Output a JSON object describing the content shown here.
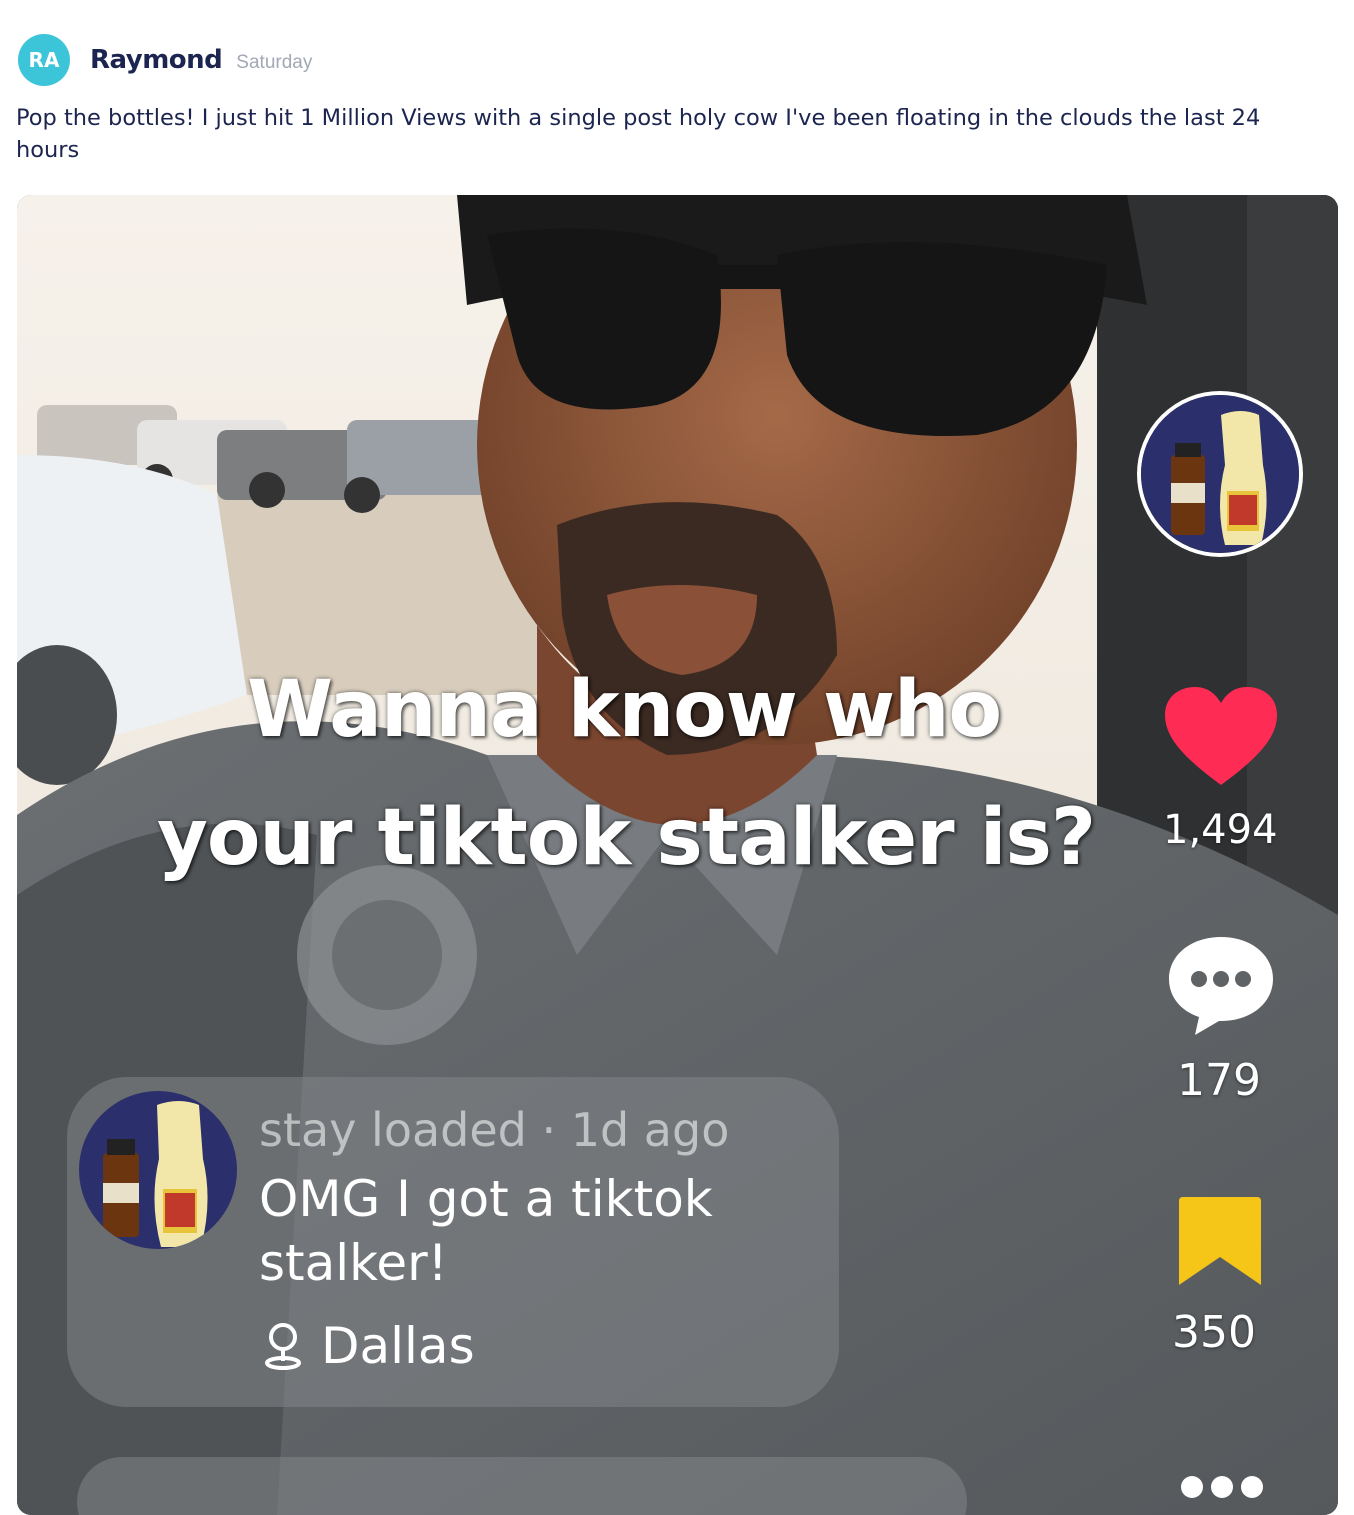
{
  "post": {
    "avatar_initials": "RA",
    "author": "Raymond",
    "time": "Saturday",
    "text": "Pop the bottles! I just hit 1 Million Views with a single post holy cow I've been floating in the clouds the last 24 hours"
  },
  "video": {
    "caption_line1": "Wanna know who",
    "caption_line2": "your tiktok stalker is?",
    "likes": "1,494",
    "comments": "179",
    "saves": "350",
    "comment_card": {
      "meta": "stay loaded · 1d ago",
      "body": "OMG I got a tiktok stalker!",
      "location": "Dallas"
    },
    "colors": {
      "like": "#fe2c55",
      "save": "#f5c518",
      "avatar_bg": "#3cc4d8"
    }
  }
}
